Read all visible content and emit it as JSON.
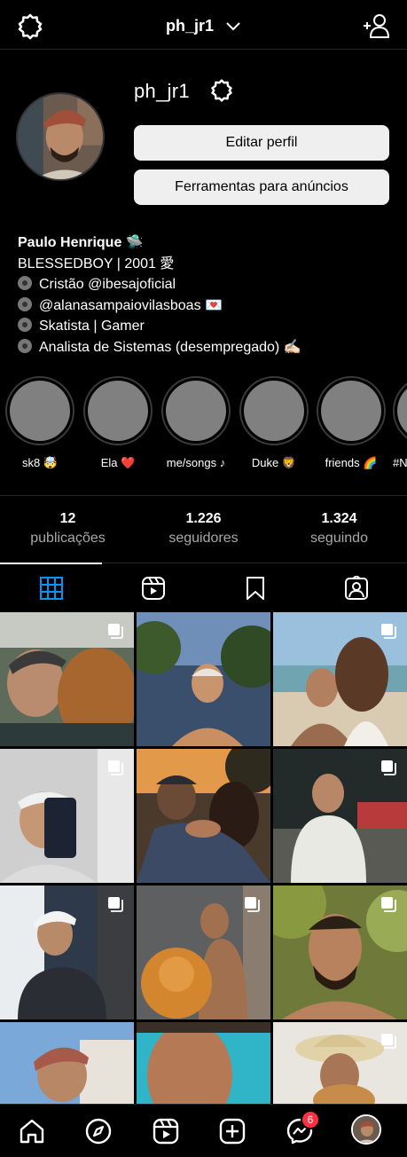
{
  "header": {
    "username": "ph_jr1"
  },
  "profile": {
    "username": "ph_jr1",
    "edit_button": "Editar perfil",
    "ads_button": "Ferramentas para anúncios"
  },
  "bio": {
    "name": "Paulo Henrique 🛸",
    "line1": "BLESSEDBOY | 2001 愛",
    "line2": "Cristão @ibesajoficial",
    "line3": "@alanasampaiovilasboas 💌",
    "line4": "Skatista | Gamer",
    "line5": "Analista de Sistemas (desempregado) ✍🏻"
  },
  "highlights": [
    {
      "label": "sk8 🤯"
    },
    {
      "label": "Ela ❤️"
    },
    {
      "label": "me/songs ♪"
    },
    {
      "label": "Duke 🦁"
    },
    {
      "label": "friends 🌈"
    },
    {
      "label": "#N"
    }
  ],
  "stats": [
    {
      "num": "12",
      "label": "publicações"
    },
    {
      "num": "1.226",
      "label": "seguidores"
    },
    {
      "num": "1.324",
      "label": "seguindo"
    }
  ],
  "tabs": [
    "grid-icon",
    "reels-icon",
    "saved-icon",
    "tagged-icon"
  ],
  "colors": {
    "accent": "#0095f6",
    "badge": "#ff3040",
    "button": "#efefef"
  },
  "notifications": {
    "messenger_count": "6"
  },
  "posts": [
    {
      "desc": "post-1",
      "multi": true
    },
    {
      "desc": "post-2",
      "multi": false
    },
    {
      "desc": "post-3",
      "multi": true
    },
    {
      "desc": "post-4",
      "multi": true
    },
    {
      "desc": "post-5",
      "multi": false
    },
    {
      "desc": "post-6",
      "multi": true
    },
    {
      "desc": "post-7",
      "multi": true
    },
    {
      "desc": "post-8",
      "multi": true
    },
    {
      "desc": "post-9",
      "multi": true
    },
    {
      "desc": "post-10",
      "multi": false
    },
    {
      "desc": "post-11",
      "multi": false
    },
    {
      "desc": "post-12",
      "multi": true
    }
  ]
}
